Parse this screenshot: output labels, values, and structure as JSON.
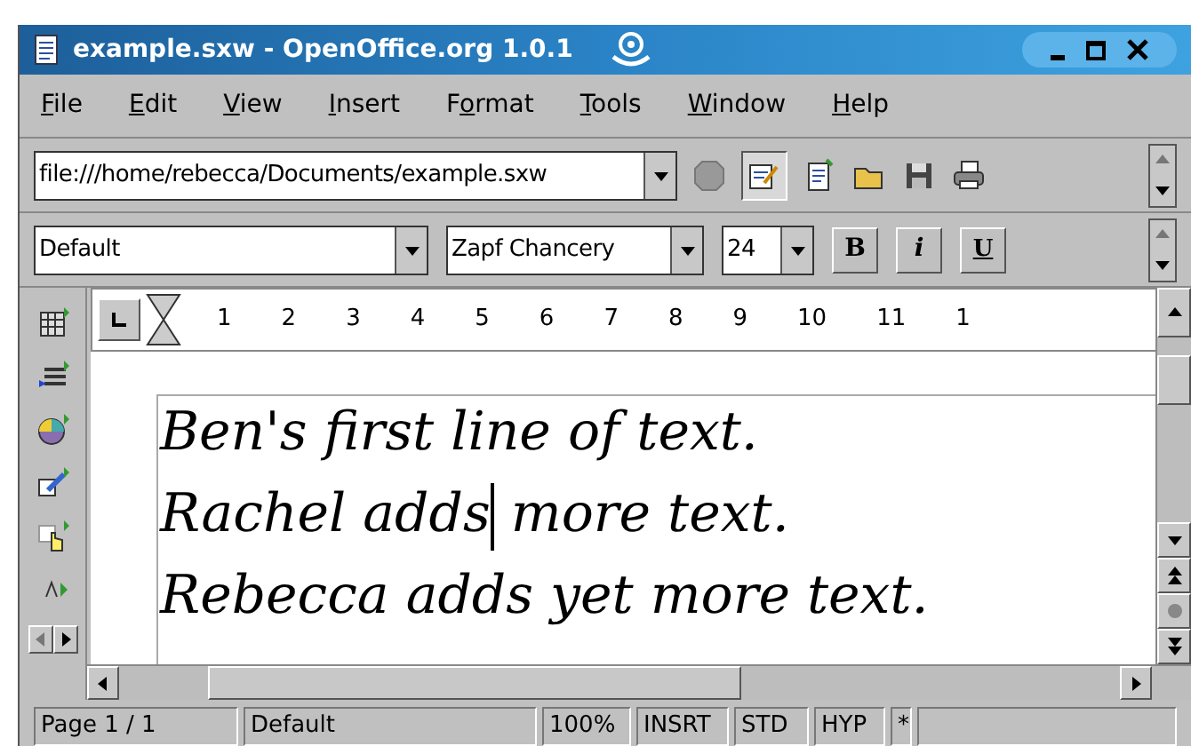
{
  "window": {
    "title": "example.sxw - OpenOffice.org 1.0.1"
  },
  "menu": [
    {
      "parts": [
        {
          "text": "F",
          "underlined": true
        },
        {
          "text": "ile",
          "underlined": false
        }
      ]
    },
    {
      "parts": [
        {
          "text": "E",
          "underlined": true
        },
        {
          "text": "dit",
          "underlined": false
        }
      ]
    },
    {
      "parts": [
        {
          "text": "V",
          "underlined": true
        },
        {
          "text": "iew",
          "underlined": false
        }
      ]
    },
    {
      "parts": [
        {
          "text": "I",
          "underlined": true
        },
        {
          "text": "nsert",
          "underlined": false
        }
      ]
    },
    {
      "parts": [
        {
          "text": "F",
          "underlined": false
        },
        {
          "text": "o",
          "underlined": true
        },
        {
          "text": "rmat",
          "underlined": false
        }
      ]
    },
    {
      "parts": [
        {
          "text": "T",
          "underlined": true
        },
        {
          "text": "ools",
          "underlined": false
        }
      ]
    },
    {
      "parts": [
        {
          "text": "W",
          "underlined": true
        },
        {
          "text": "indow",
          "underlined": false
        }
      ]
    },
    {
      "parts": [
        {
          "text": "H",
          "underlined": true
        },
        {
          "text": "elp",
          "underlined": false
        }
      ]
    }
  ],
  "function_bar": {
    "url": "file:///home/rebecca/Documents/example.sxw",
    "edit_mode": {
      "selected": true
    }
  },
  "format_bar": {
    "style": "Default",
    "font": "Zapf Chancery",
    "size": "24",
    "bold": "B",
    "italic": "i",
    "underline": "U"
  },
  "ruler": {
    "numbers": [
      "1",
      "2",
      "3",
      "4",
      "5",
      "6",
      "7",
      "8",
      "9",
      "10",
      "11",
      "1"
    ]
  },
  "document": {
    "lines": [
      {
        "before_cursor": "Ben's first line of text.",
        "has_cursor": false
      },
      {
        "before_cursor": "Rachel adds",
        "after_cursor": " more text.",
        "has_cursor": true
      },
      {
        "before_cursor": "Rebecca adds yet more text.",
        "has_cursor": false
      }
    ]
  },
  "status_bar": {
    "page": "Page 1 / 1",
    "style": "Default",
    "zoom": "100%",
    "insert_mode": "INSRT",
    "selection_mode": "STD",
    "hyperlink_mode": "HYP",
    "modified": "*"
  }
}
